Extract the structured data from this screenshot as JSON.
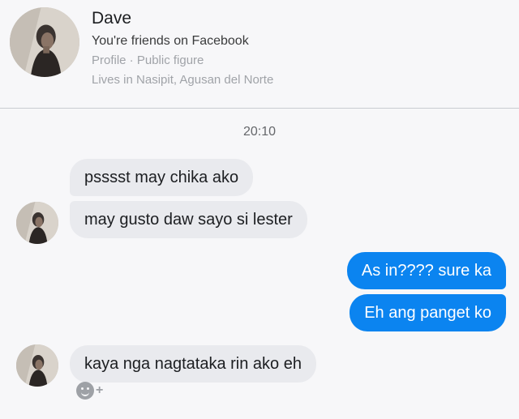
{
  "contact": {
    "name": "Dave",
    "relationship": "You're friends on Facebook",
    "profile_info": "Profile · Public figure",
    "location": "Lives in Nasipit, Agusan del Norte"
  },
  "timestamp": "20:10",
  "messages": [
    {
      "sender": "Dave",
      "text": "psssst may chika ako"
    },
    {
      "sender": "Dave",
      "text": "may gusto daw sayo si lester"
    },
    {
      "sender": "me",
      "text": "As in???? sure ka"
    },
    {
      "sender": "me",
      "text": "Eh ang panget ko"
    },
    {
      "sender": "Dave",
      "text": "kaya nga nagtataka rin ako eh"
    }
  ],
  "icons": {
    "reaction": "smiley-add-icon",
    "plus": "+"
  },
  "colors": {
    "outgoing_bubble": "#0b84f0",
    "incoming_bubble": "#e9eaee",
    "background": "#f7f7f9"
  }
}
